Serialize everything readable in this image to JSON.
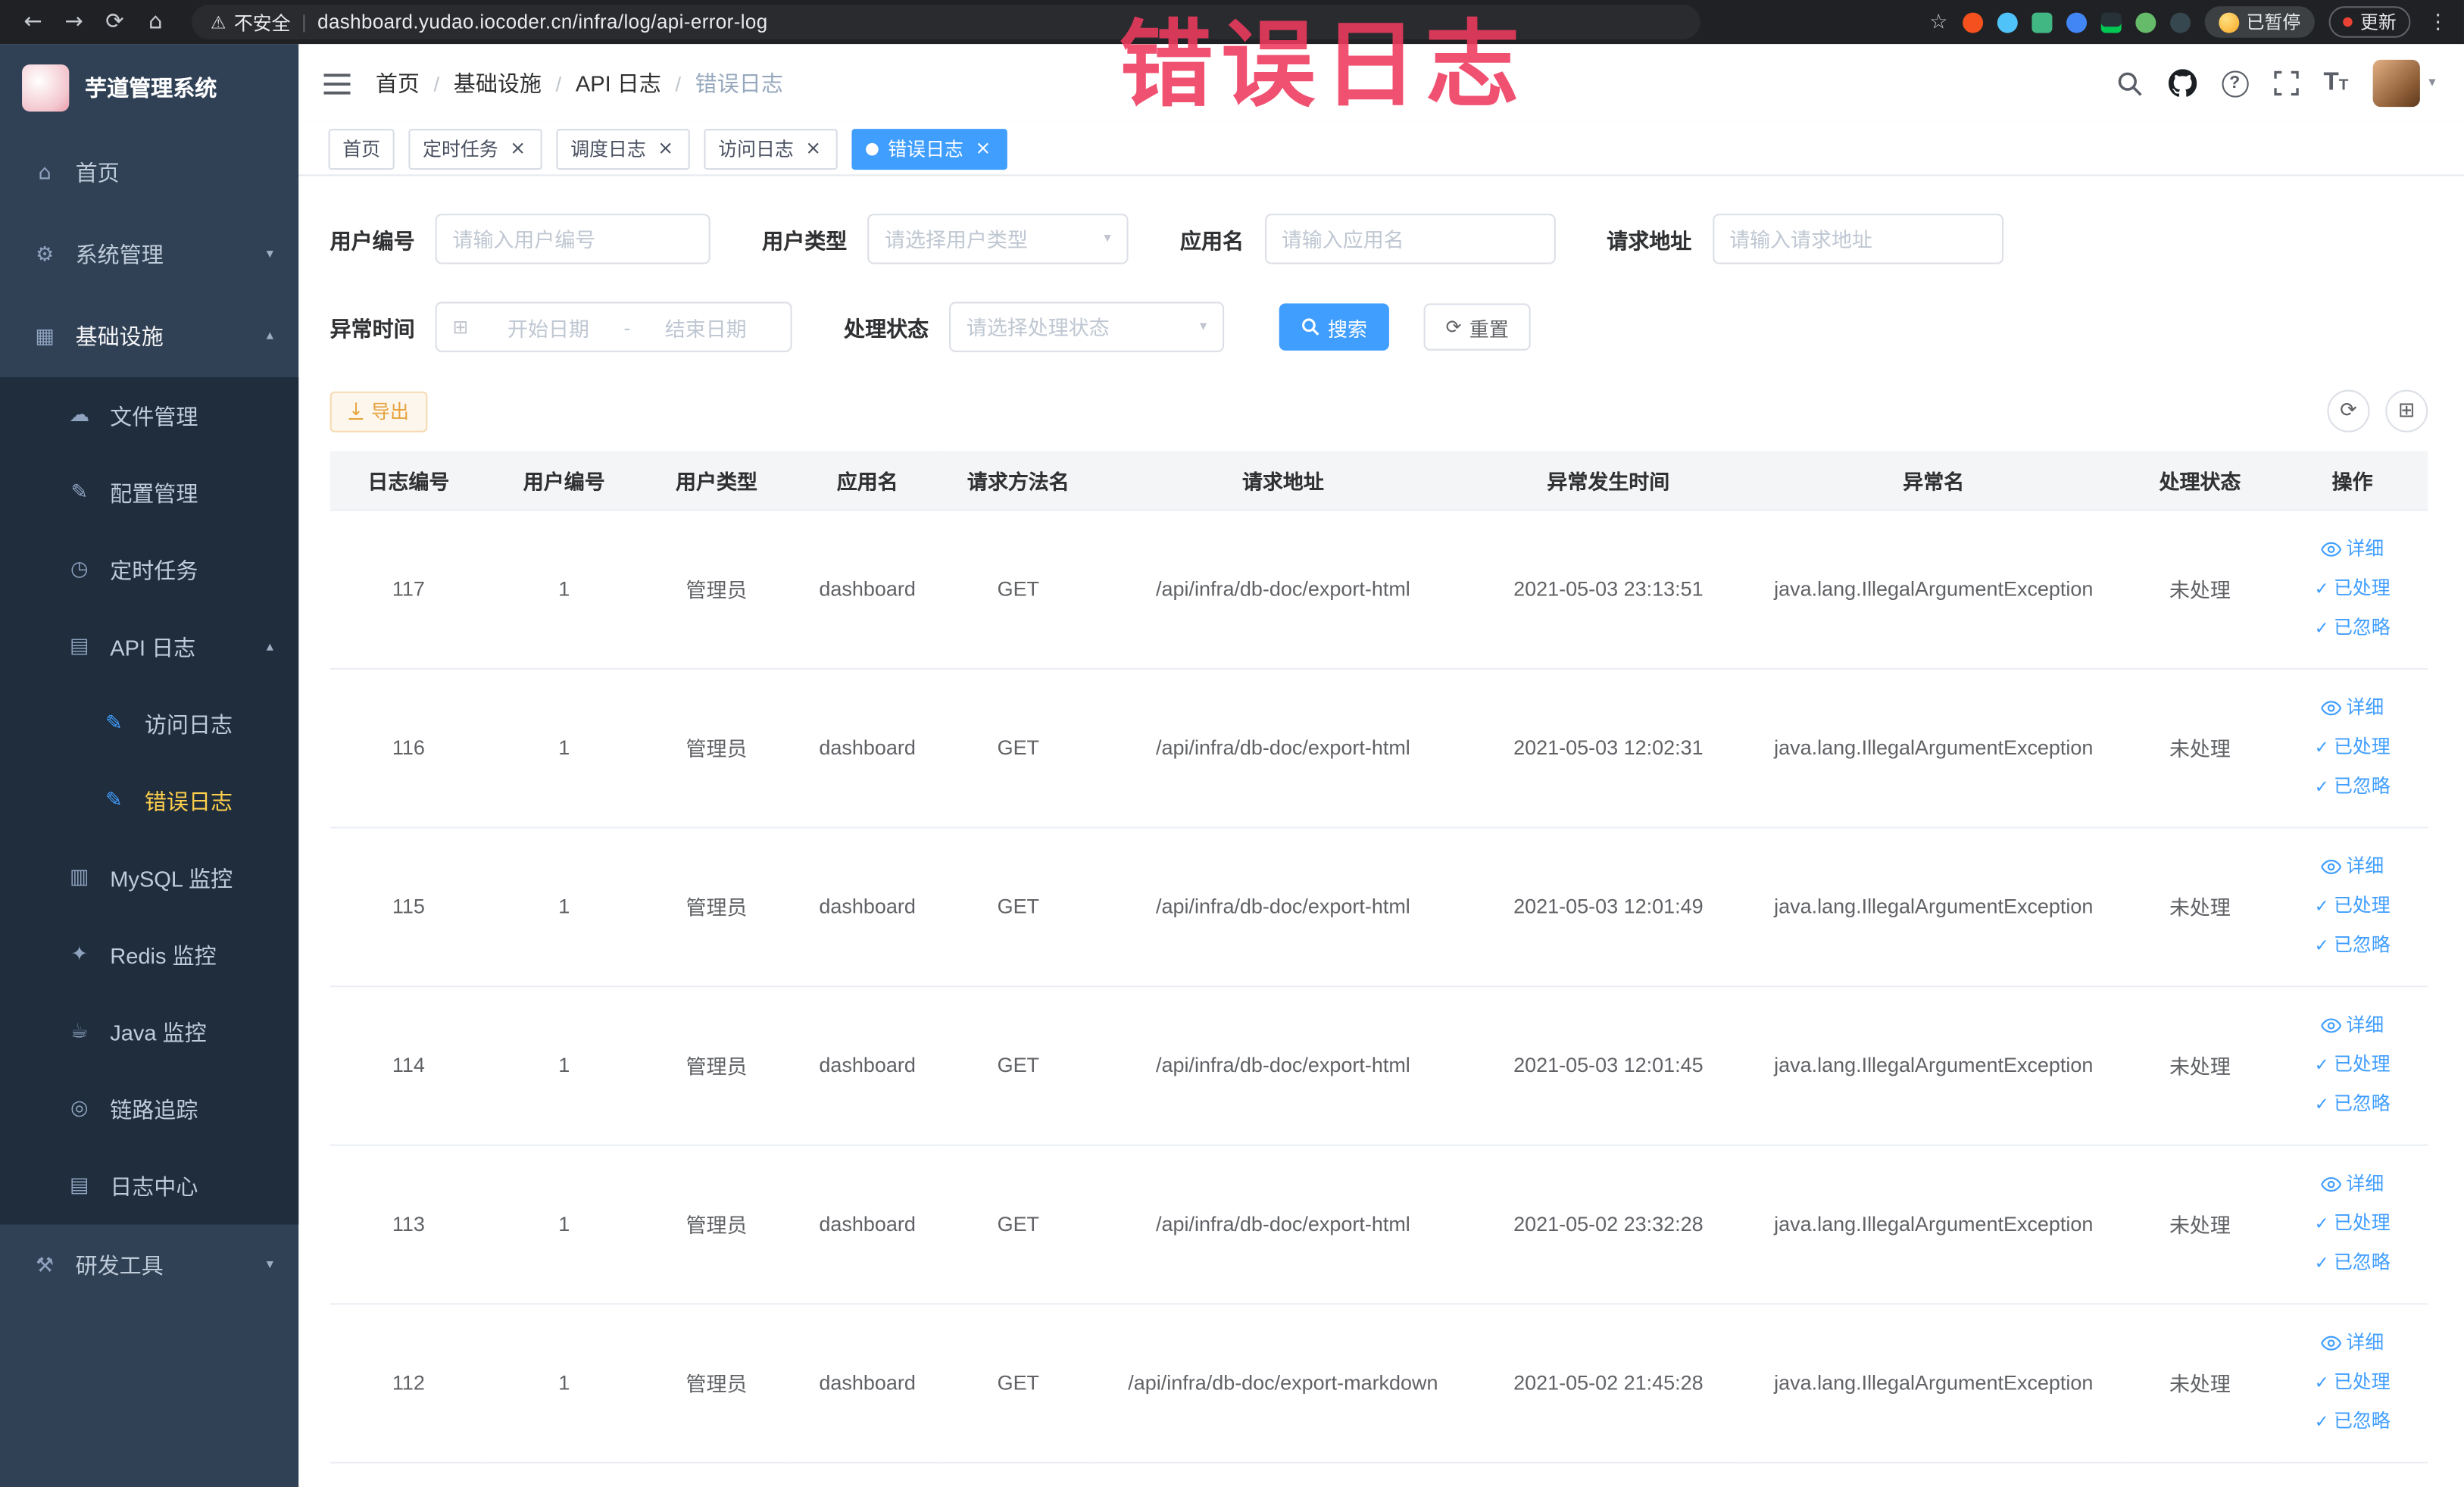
{
  "browser": {
    "security": "不安全",
    "url": "dashboard.yudao.iocoder.cn/infra/log/api-error-log",
    "paused": "已暂停",
    "update": "更新"
  },
  "annotation": {
    "text": "错误日志"
  },
  "icons": {
    "back": "←",
    "forward": "→",
    "reload": "⟳",
    "home": "⌂",
    "warning": "⚠",
    "star": "☆",
    "kebab": "⋮",
    "chevron_down": "▾",
    "chevron_up": "▴",
    "close": "×",
    "question": "?",
    "text_large": "T",
    "text_small": "T",
    "calendar": "⊞",
    "download": "↓",
    "refresh": "⟳",
    "columns": "⊞",
    "check": "✓",
    "reset": "⟳"
  },
  "sidebar": {
    "logo": "芋道管理系统",
    "items": [
      {
        "label": "首页",
        "glyph": "⌂"
      },
      {
        "label": "系统管理",
        "glyph": "⚙"
      },
      {
        "label": "基础设施",
        "glyph": "▦"
      },
      {
        "label": "文件管理",
        "glyph": "☁"
      },
      {
        "label": "配置管理",
        "glyph": "✎"
      },
      {
        "label": "定时任务",
        "glyph": "◷"
      },
      {
        "label": "API 日志",
        "glyph": "▤"
      },
      {
        "label": "访问日志",
        "glyph": "✎"
      },
      {
        "label": "错误日志",
        "glyph": "✎"
      },
      {
        "label": "MySQL 监控",
        "glyph": "▥"
      },
      {
        "label": "Redis 监控",
        "glyph": "✦"
      },
      {
        "label": "Java 监控",
        "glyph": "☕"
      },
      {
        "label": "链路追踪",
        "glyph": "◎"
      },
      {
        "label": "日志中心",
        "glyph": "▤"
      },
      {
        "label": "研发工具",
        "glyph": "⚒"
      }
    ]
  },
  "breadcrumb": [
    "首页",
    "基础设施",
    "API 日志",
    "错误日志"
  ],
  "breadcrumb_sep": "/",
  "tabs": [
    {
      "label": "首页"
    },
    {
      "label": "定时任务"
    },
    {
      "label": "调度日志"
    },
    {
      "label": "访问日志"
    },
    {
      "label": "错误日志"
    }
  ],
  "filters": {
    "user_id_label": "用户编号",
    "user_id_placeholder": "请输入用户编号",
    "user_type_label": "用户类型",
    "user_type_placeholder": "请选择用户类型",
    "app_label": "应用名",
    "app_placeholder": "请输入应用名",
    "url_label": "请求地址",
    "url_placeholder": "请输入请求地址",
    "time_label": "异常时间",
    "time_start_placeholder": "开始日期",
    "time_separator": "-",
    "time_end_placeholder": "结束日期",
    "status_label": "处理状态",
    "status_placeholder": "请选择处理状态",
    "search": "搜索",
    "reset": "重置"
  },
  "toolbar": {
    "export": "导出"
  },
  "table": {
    "columns": [
      "日志编号",
      "用户编号",
      "用户类型",
      "应用名",
      "请求方法名",
      "请求地址",
      "异常发生时间",
      "异常名",
      "处理状态",
      "操作"
    ],
    "actions": {
      "detail": "详细",
      "processed": "已处理",
      "ignored": "已忽略"
    },
    "rows": [
      {
        "id": "117",
        "user_id": "1",
        "user_type": "管理员",
        "app": "dashboard",
        "method": "GET",
        "url": "/api/infra/db-doc/export-html",
        "time": "2021-05-03 23:13:51",
        "exception": "java.lang.IllegalArgumentException",
        "status": "未处理"
      },
      {
        "id": "116",
        "user_id": "1",
        "user_type": "管理员",
        "app": "dashboard",
        "method": "GET",
        "url": "/api/infra/db-doc/export-html",
        "time": "2021-05-03 12:02:31",
        "exception": "java.lang.IllegalArgumentException",
        "status": "未处理"
      },
      {
        "id": "115",
        "user_id": "1",
        "user_type": "管理员",
        "app": "dashboard",
        "method": "GET",
        "url": "/api/infra/db-doc/export-html",
        "time": "2021-05-03 12:01:49",
        "exception": "java.lang.IllegalArgumentException",
        "status": "未处理"
      },
      {
        "id": "114",
        "user_id": "1",
        "user_type": "管理员",
        "app": "dashboard",
        "method": "GET",
        "url": "/api/infra/db-doc/export-html",
        "time": "2021-05-03 12:01:45",
        "exception": "java.lang.IllegalArgumentException",
        "status": "未处理"
      },
      {
        "id": "113",
        "user_id": "1",
        "user_type": "管理员",
        "app": "dashboard",
        "method": "GET",
        "url": "/api/infra/db-doc/export-html",
        "time": "2021-05-02 23:32:28",
        "exception": "java.lang.IllegalArgumentException",
        "status": "未处理"
      },
      {
        "id": "112",
        "user_id": "1",
        "user_type": "管理员",
        "app": "dashboard",
        "method": "GET",
        "url": "/api/infra/db-doc/export-markdown",
        "time": "2021-05-02 21:45:28",
        "exception": "java.lang.IllegalArgumentException",
        "status": "未处理"
      }
    ]
  }
}
